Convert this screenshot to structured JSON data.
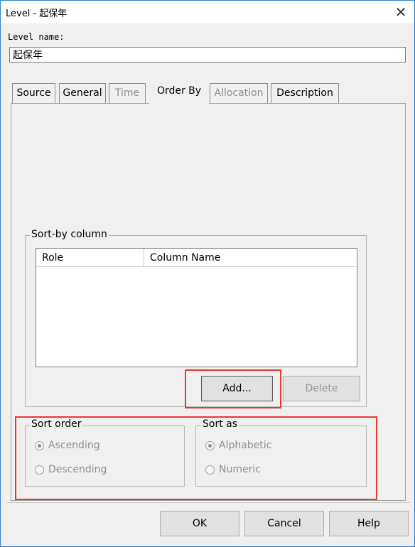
{
  "window": {
    "title": "Level - 起保年",
    "close_glyph": "✕"
  },
  "level_name": {
    "label": "Level name:",
    "value": "起保年"
  },
  "tabs": [
    {
      "label": "Source",
      "enabled": true
    },
    {
      "label": "General",
      "enabled": true
    },
    {
      "label": "Time",
      "enabled": false
    },
    {
      "label": "Order By",
      "enabled": true,
      "selected": true
    },
    {
      "label": "Allocation",
      "enabled": false
    },
    {
      "label": "Description",
      "enabled": true
    }
  ],
  "sort_by_column": {
    "legend": "Sort-by column",
    "columns": [
      "Role",
      "Column Name"
    ],
    "rows": [],
    "add_label": "Add...",
    "delete_label": "Delete"
  },
  "sort_order": {
    "legend": "Sort order",
    "options": [
      {
        "label": "Ascending",
        "selected": true
      },
      {
        "label": "Descending",
        "selected": false
      }
    ]
  },
  "sort_as": {
    "legend": "Sort as",
    "options": [
      {
        "label": "Alphabetic",
        "selected": true
      },
      {
        "label": "Numeric",
        "selected": false
      }
    ]
  },
  "footer": {
    "ok_label": "OK",
    "cancel_label": "Cancel",
    "help_label": "Help"
  },
  "colors": {
    "frame_border": "#2f7fd8",
    "dialog_bg": "#f0f0f0",
    "highlight": "#e53935",
    "disabled_text": "#8f8f8f"
  }
}
